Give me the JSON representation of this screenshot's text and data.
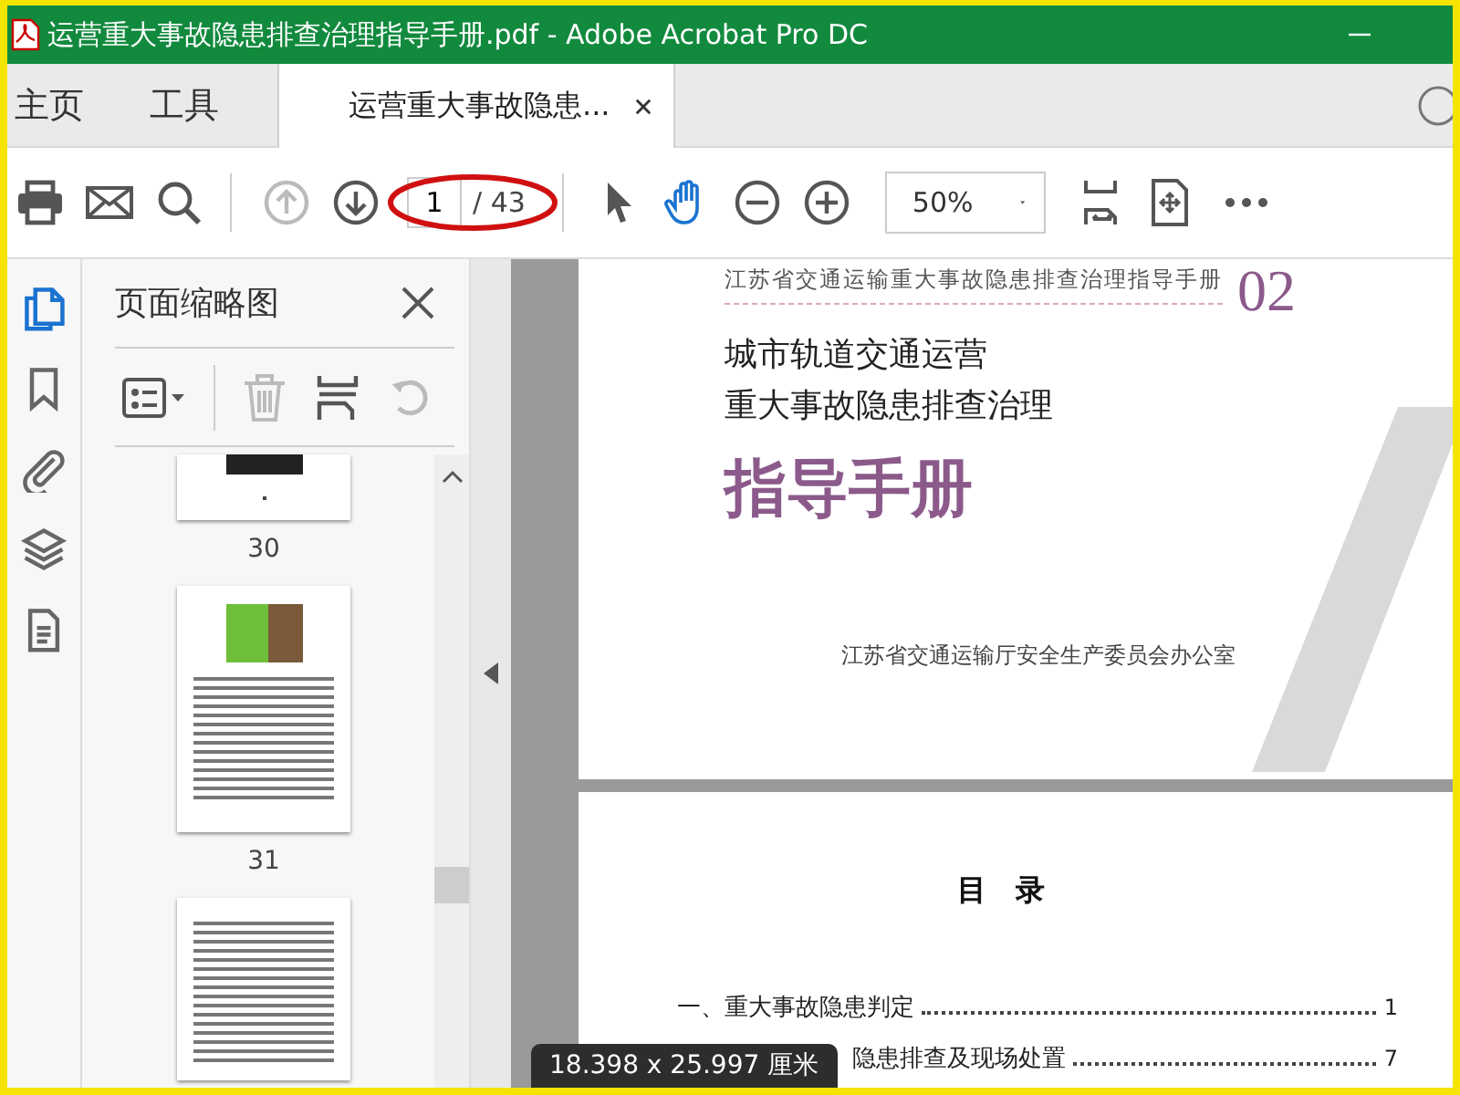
{
  "window": {
    "title": "运营重大事故隐患排查治理指导手册.pdf - Adobe Acrobat Pro DC"
  },
  "nav_tabs": [
    {
      "label": "主页",
      "selected": false
    },
    {
      "label": "工具",
      "selected": false
    }
  ],
  "doc_tab": {
    "label": "运营重大事故隐患...",
    "selected": true
  },
  "toolbar": {
    "prev_page_disabled": true,
    "next_page_disabled": false,
    "page_current": "1",
    "page_total": "/ 43",
    "hand_tool_selected": true,
    "zoom": "50%",
    "page_field_circled": true
  },
  "sidebar": {
    "items": [
      {
        "kind": "pages",
        "selected": true
      },
      {
        "kind": "bookmarks",
        "selected": false
      },
      {
        "kind": "attachments",
        "selected": false
      },
      {
        "kind": "layers",
        "selected": false
      },
      {
        "kind": "document",
        "selected": false
      }
    ]
  },
  "panel": {
    "title": "页面缩略图",
    "delete_disabled": true,
    "rotate_disabled": true,
    "thumbnails": [
      {
        "kind": "photo_end",
        "label": "30"
      },
      {
        "kind": "photo_text",
        "label": "31"
      },
      {
        "kind": "text"
      }
    ]
  },
  "document": {
    "cover": {
      "series": "江苏省交通运输重大事故隐患排查治理指导手册",
      "number": "02",
      "title_lines": [
        "城市轨道交通运营",
        "重大事故隐患排查治理"
      ],
      "main_title": "指导手册",
      "publisher": "江苏省交通运输厅安全生产委员会办公室"
    },
    "contents": {
      "heading": "目　录",
      "entries": [
        {
          "title": "一、重大事故隐患判定",
          "page": "1"
        },
        {
          "title": "隐患排查及现场处置",
          "page": "7"
        }
      ]
    }
  },
  "tooltip": "18.398 x 25.997 厘米"
}
